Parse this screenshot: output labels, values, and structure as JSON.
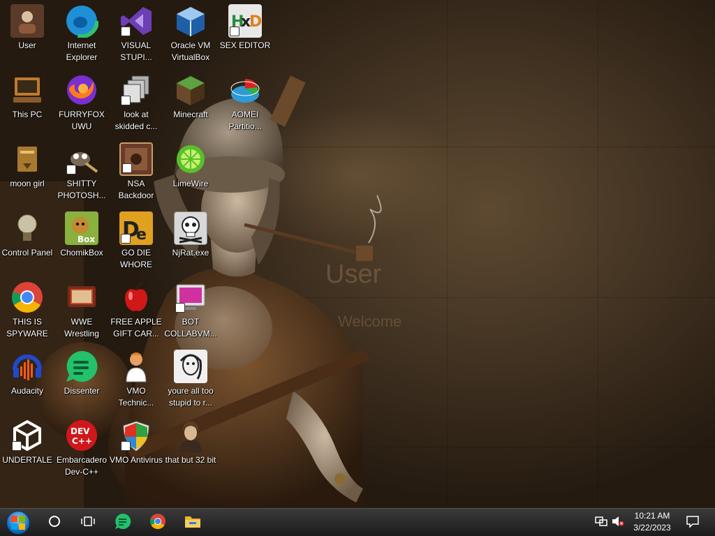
{
  "desktop": {
    "wallpaper_text": {
      "user": "User",
      "welcome": "Welcome"
    },
    "icons": [
      {
        "label": "User",
        "icon": "user-folder-icon",
        "color": "#5b3a2a"
      },
      {
        "label": "Internet Explorer",
        "icon": "edge-icon",
        "color": "#1f8fd6"
      },
      {
        "label": "VISUAL STUPI...",
        "icon": "visual-studio-icon",
        "color": "#6d3fb7"
      },
      {
        "label": "Oracle VM VirtualBox",
        "icon": "virtualbox-icon",
        "color": "#1f5fa8"
      },
      {
        "label": "SEX EDITOR",
        "icon": "hex-editor-icon",
        "color": "#e8e8e8"
      },
      {
        "label": "This PC",
        "icon": "computer-icon",
        "color": "#c07a30"
      },
      {
        "label": "FURRYFOX UWU",
        "icon": "firefox-icon",
        "color": "#ff7a1a"
      },
      {
        "label": "look at skidded c...",
        "icon": "copy-pages-icon",
        "color": "#8a8a8a"
      },
      {
        "label": "Minecraft",
        "icon": "minecraft-block-icon",
        "color": "#5a7a3a"
      },
      {
        "label": "AOMEI Partitio...",
        "icon": "aomei-partition-icon",
        "color": "#2f9ad8"
      },
      {
        "label": "moon girl",
        "icon": "folder-icon",
        "color": "#a87a30"
      },
      {
        "label": "SHITTY PHOTOSH...",
        "icon": "gimp-icon",
        "color": "#7a6a55"
      },
      {
        "label": "NSA Backdoor",
        "icon": "nsa-picture-icon",
        "color": "#6a3a2a"
      },
      {
        "label": "LimeWire",
        "icon": "limewire-icon",
        "color": "#58c02a"
      },
      {
        "label": "Control Panel",
        "icon": "lightbulb-icon",
        "color": "#c9c2a5"
      },
      {
        "label": "ChomikBox",
        "icon": "chomikbox-icon",
        "color": "#c48a30"
      },
      {
        "label": "GO DIE WHORE",
        "icon": "die-letters-icon",
        "color": "#e0a020"
      },
      {
        "label": "NjRat.exe",
        "icon": "skull-icon",
        "color": "#d8d8d8"
      },
      {
        "label": "THIS IS SPYWARE",
        "icon": "chrome-icon",
        "color": "#db4437"
      },
      {
        "label": "WWE Wrestling",
        "icon": "wrestling-tv-icon",
        "color": "#7a2a1a"
      },
      {
        "label": "FREE APPLE GIFT CAR...",
        "icon": "apple-icon",
        "color": "#d01818"
      },
      {
        "label": "BOT COLLABVM...",
        "icon": "monitor-icon",
        "color": "#d030a0"
      },
      {
        "label": "Audacity",
        "icon": "audacity-icon",
        "color": "#1f4ad0"
      },
      {
        "label": "Dissenter",
        "icon": "dissenter-icon",
        "color": "#23c16b"
      },
      {
        "label": "VMO Technic...",
        "icon": "technician-icon",
        "color": "#e8a060"
      },
      {
        "label": "youre all too stupid to r...",
        "icon": "portrait-sketch-icon",
        "color": "#f0f0f0"
      },
      {
        "label": "UNDERTALE",
        "icon": "unity-icon",
        "color": "#222222"
      },
      {
        "label": "Embarcadero Dev-C++",
        "icon": "devcpp-icon",
        "color": "#d0181c"
      },
      {
        "label": "VMO Antivirus",
        "icon": "shield-icon",
        "color": "#2a8ad8"
      },
      {
        "label": "that but 32 bit",
        "icon": "portrait-painting-icon",
        "color": "#8a6a50"
      }
    ]
  },
  "taskbar": {
    "start": "windows-start-icon",
    "pinned": [
      {
        "name": "cortana",
        "icon": "cortana-circle-icon"
      },
      {
        "name": "task-view",
        "icon": "task-view-icon"
      },
      {
        "name": "dissenter",
        "icon": "dissenter-icon"
      },
      {
        "name": "chrome",
        "icon": "chrome-icon"
      },
      {
        "name": "file-explorer",
        "icon": "folder-icon"
      }
    ],
    "tray": {
      "network": "network-icon",
      "volume": "volume-muted-icon",
      "time": "10:21 AM",
      "date": "3/22/2023",
      "notifications": "action-center-icon"
    }
  }
}
